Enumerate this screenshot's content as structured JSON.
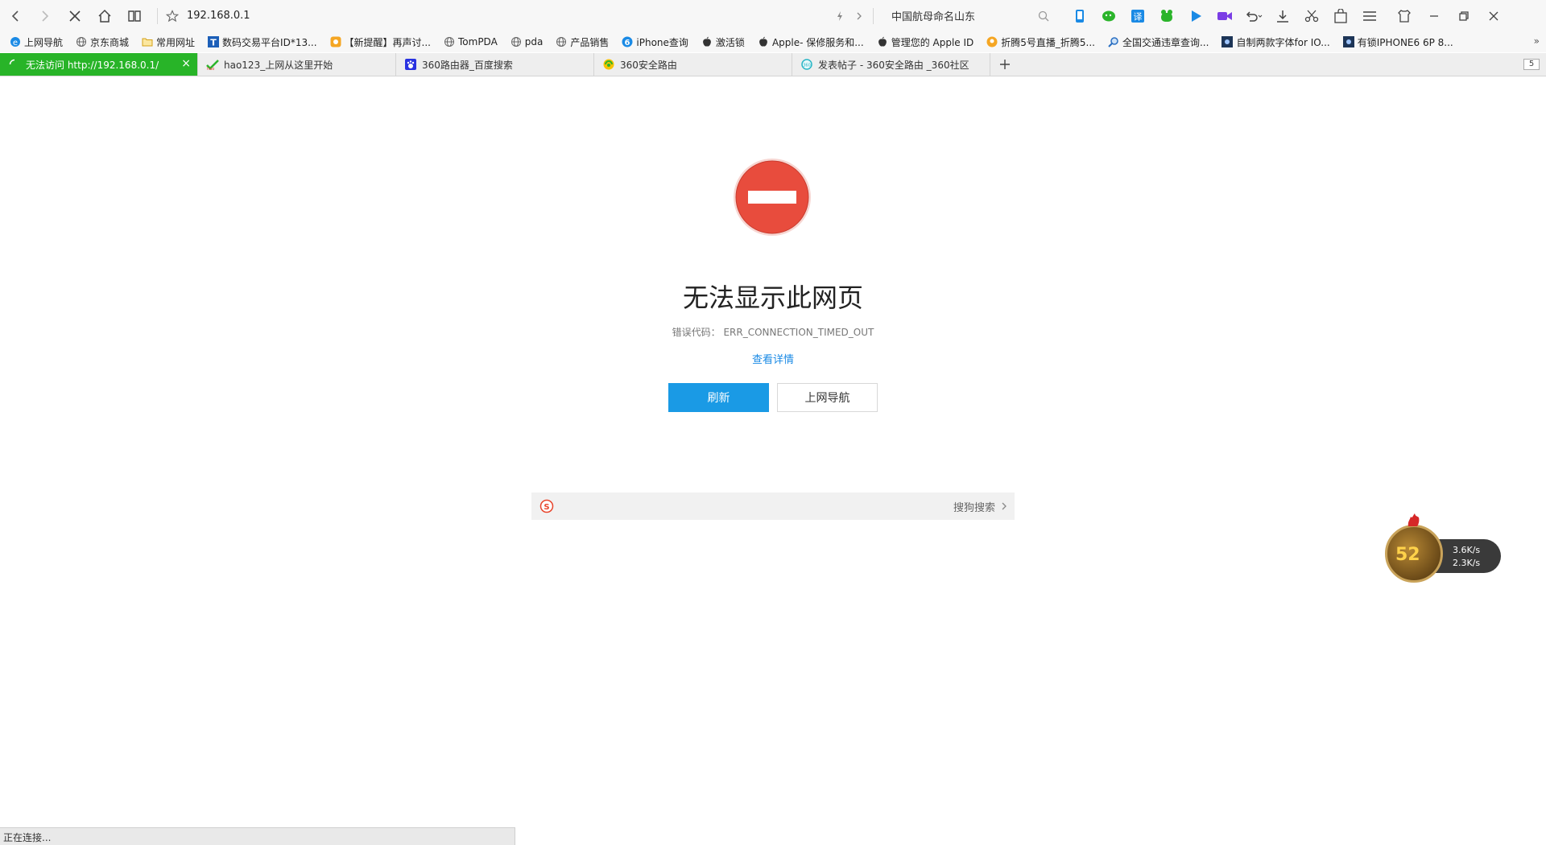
{
  "toolbar": {
    "url": "192.168.0.1",
    "search_text": "中国航母命名山东"
  },
  "bookmarks": [
    {
      "label": "上网导航",
      "icon": "ie-icon"
    },
    {
      "label": "京东商城",
      "icon": "globe-icon"
    },
    {
      "label": "常用网址",
      "icon": "folder-icon"
    },
    {
      "label": "数码交易平台ID*13...",
      "icon": "t-logo-icon"
    },
    {
      "label": "【新提醒】再声讨...",
      "icon": "forum-icon"
    },
    {
      "label": "TomPDA",
      "icon": "globe-icon"
    },
    {
      "label": "pda",
      "icon": "globe-icon"
    },
    {
      "label": "产品销售",
      "icon": "globe-icon"
    },
    {
      "label": "iPhone查询",
      "icon": "blue-6-icon"
    },
    {
      "label": "激活锁",
      "icon": "apple-icon"
    },
    {
      "label": "Apple- 保修服务和...",
      "icon": "apple-icon"
    },
    {
      "label": "管理您的 Apple ID",
      "icon": "apple-icon"
    },
    {
      "label": "折腾5号直播_折腾5...",
      "icon": "avatar-icon"
    },
    {
      "label": "全国交通违章查询...",
      "icon": "magnifier-icon"
    },
    {
      "label": "自制两款字体for IO...",
      "icon": "dark-square-icon"
    },
    {
      "label": "有锁IPHONE6 6P 8...",
      "icon": "dark-square-icon"
    }
  ],
  "tabs": [
    {
      "label": "无法访问 http://192.168.0.1/",
      "active": true
    },
    {
      "label": "hao123_上网从这里开始",
      "active": false
    },
    {
      "label": "360路由器_百度搜索",
      "active": false
    },
    {
      "label": "360安全路由",
      "active": false
    },
    {
      "label": "发表帖子 - 360安全路由 _360社区",
      "active": false
    }
  ],
  "tab_count": "5",
  "error": {
    "title": "无法显示此网页",
    "code": "错误代码： ERR_CONNECTION_TIMED_OUT",
    "details_link": "查看详情",
    "refresh_label": "刷新",
    "nav_label": "上网导航"
  },
  "sogou": {
    "label": "搜狗搜索"
  },
  "speed_widget": {
    "percent": "52",
    "upload": "3.6K/s",
    "download": "2.3K/s"
  },
  "status": {
    "text": "正在连接..."
  },
  "colors": {
    "active_tab": "#28b428",
    "primary_button": "#1a9ae5",
    "link": "#1a8ae5",
    "error_red": "#e84c3d"
  }
}
